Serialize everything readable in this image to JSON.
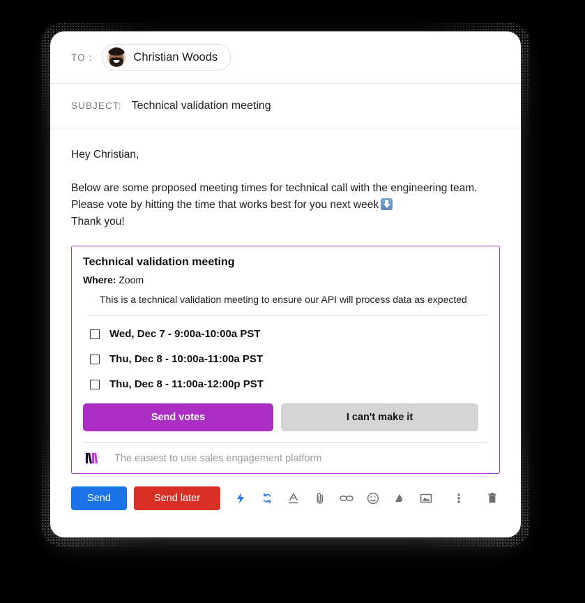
{
  "window": {
    "to": {
      "label": "TO :",
      "recipient_name": "Christian Woods",
      "avatar_name": "christian-woods-avatar"
    },
    "subject": {
      "label": "SUBJECT:",
      "value": "Technical validation meeting"
    },
    "body": {
      "greeting": "Hey Christian,",
      "paragraph_part1": "Below are some proposed meeting times for technical call with the engineering team.  Please vote by hitting the time that works best for you next week",
      "emoji": "down-arrow-emoji",
      "closing": "Thank you!"
    },
    "meeting_card": {
      "title": "Technical validation meeting",
      "where_label": "Where:",
      "where_value": "Zoom",
      "description": "This is a technical validation meeting to ensure our API will process data as expected",
      "options": [
        {
          "label": "Wed, Dec 7 - 9:00a-10:00a PST",
          "checked": false
        },
        {
          "label": "Thu, Dec 8 - 10:00a-11:00a PST",
          "checked": false
        },
        {
          "label": "Thu, Dec 8 - 11:00a-12:00p PST",
          "checked": false
        }
      ],
      "send_votes_label": "Send votes",
      "cant_make_it_label": "I can't make it",
      "brand_logo_name": "mixmax-m-logo",
      "brand_tagline": "The easiest to use sales engagement platform",
      "border_color": "#a33bc2",
      "send_votes_color": "#ab2fc4",
      "cant_make_it_color": "#d4d4d4"
    },
    "toolbar": {
      "send_label": "Send",
      "send_later_label": "Send later",
      "send_color": "#1a73e8",
      "send_later_color": "#d93025",
      "icons": [
        {
          "name": "lightning-bolt-icon",
          "color": "#2b7de9"
        },
        {
          "name": "sync-refresh-icon",
          "color": "#2b7de9"
        },
        {
          "name": "text-format-icon",
          "color": "#6e6e6e"
        },
        {
          "name": "attachment-paperclip-icon",
          "color": "#6e6e6e"
        },
        {
          "name": "insert-link-icon",
          "color": "#6e6e6e"
        },
        {
          "name": "emoji-icon",
          "color": "#6e6e6e"
        },
        {
          "name": "google-drive-icon",
          "color": "#6e6e6e"
        },
        {
          "name": "insert-image-icon",
          "color": "#6e6e6e"
        }
      ],
      "more_options_name": "more-options-icon",
      "discard_name": "discard-trash-icon"
    }
  }
}
